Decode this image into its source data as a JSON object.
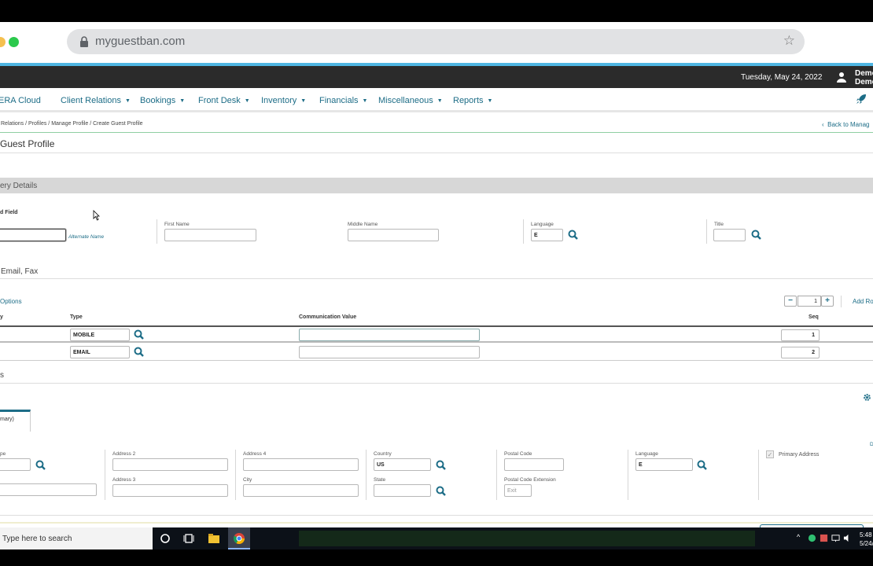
{
  "browser": {
    "url": "myguestban.com"
  },
  "topbar": {
    "date": "Tuesday, May 24, 2022",
    "user_line1": "Demo",
    "user_line2": "Demo"
  },
  "menu": {
    "brand": "ERA Cloud",
    "items": [
      {
        "label": "Client Relations"
      },
      {
        "label": "Bookings"
      },
      {
        "label": "Front Desk"
      },
      {
        "label": "Inventory"
      },
      {
        "label": "Financials"
      },
      {
        "label": "Miscellaneous"
      },
      {
        "label": "Reports"
      }
    ]
  },
  "breadcrumb": "Relations / Profiles / Manage Profile / Create Guest Profile",
  "back_link": "Back to Manag",
  "page_title": "Guest Profile",
  "section_primary": "ery Details",
  "name_block": {
    "required_label": "d Field",
    "alternate_name_link": "Alternate Name",
    "first_name_label": "First Name",
    "middle_name_label": "Middle Name",
    "language_label": "Language",
    "language_value": "E",
    "title_label": "Title"
  },
  "communication": {
    "heading": "Email, Fax",
    "options_link": "Options",
    "stepper_value": "1",
    "add_rows_link": "Add Ro",
    "col_primary": "y",
    "col_type": "Type",
    "col_value": "Communication Value",
    "col_seq": "Seq",
    "rows": [
      {
        "type": "MOBILE",
        "value": "",
        "seq": "1"
      },
      {
        "type": "EMAIL",
        "value": "",
        "seq": "2"
      }
    ]
  },
  "addresses": {
    "heading": "s",
    "tab_label": "mary)",
    "type_label": "pe",
    "address2_label": "Address 2",
    "address3_label": "Address 3",
    "address4_label": "Address 4",
    "city_label": "City",
    "country_label": "Country",
    "country_value": "US",
    "state_label": "State",
    "postal_label": "Postal Code",
    "postal_ext_label": "Postal Code Extension",
    "postal_ext_placeholder": "Exit",
    "language_label": "Language",
    "language_value": "E",
    "primary_address_label": "Primary Address",
    "edge_label": "D"
  },
  "taskbar": {
    "search_placeholder": "Type here to search",
    "time": "5:48",
    "date": "5/24/2"
  }
}
